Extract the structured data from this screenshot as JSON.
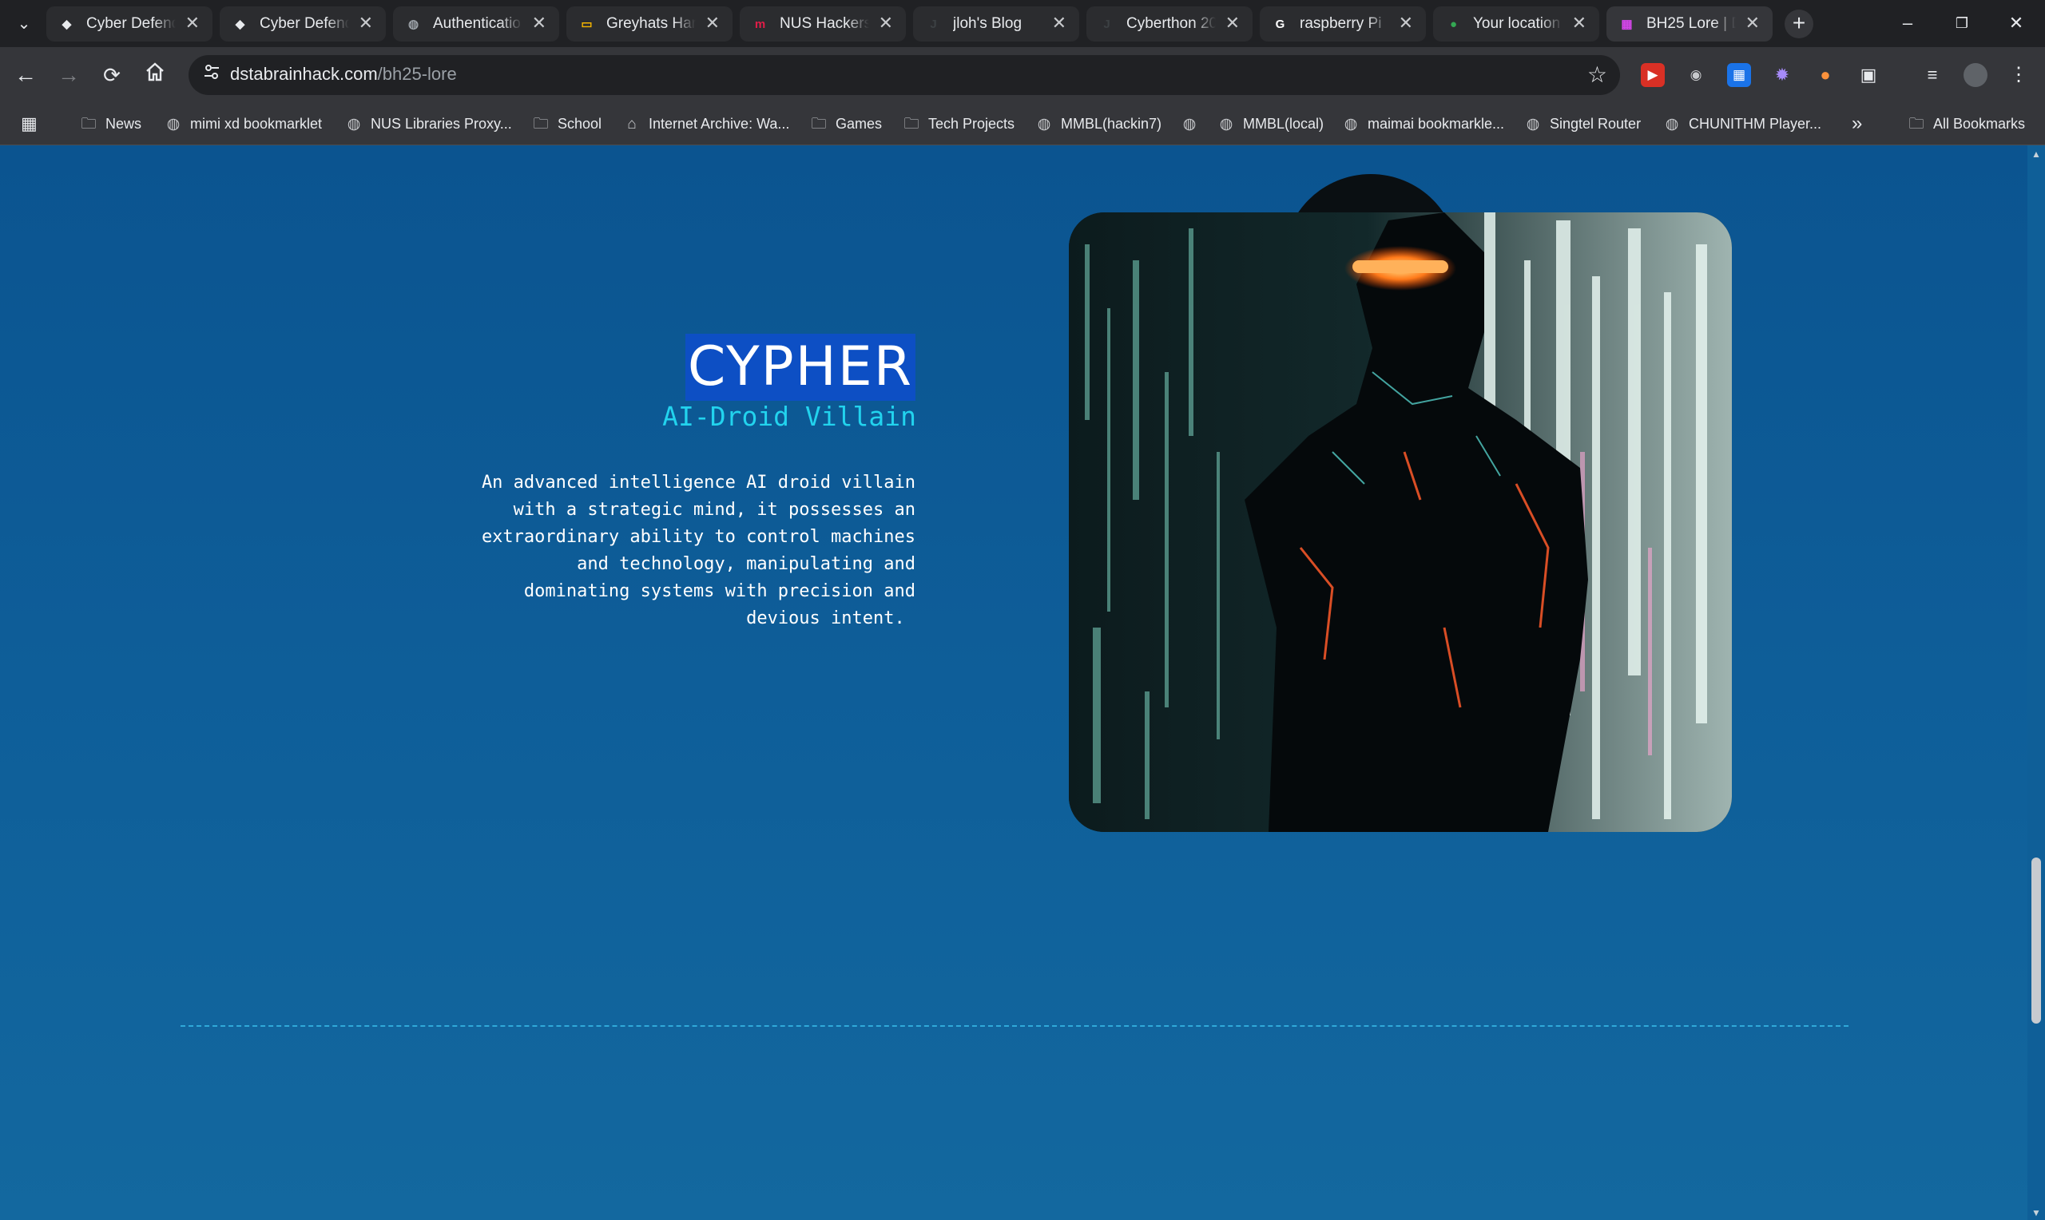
{
  "browser": {
    "tabs": [
      {
        "title": "Cyber Defend",
        "icon": "shield-favicon",
        "color": "#e8eaed"
      },
      {
        "title": "Cyber Defend",
        "icon": "shield-favicon",
        "color": "#e8eaed"
      },
      {
        "title": "Authenticatio",
        "icon": "globe-favicon",
        "color": "#9aa0a6"
      },
      {
        "title": "Greyhats Harc",
        "icon": "slides-favicon",
        "color": "#f4b400"
      },
      {
        "title": "NUS Hackers",
        "icon": "nus-favicon",
        "color": "#e11d48"
      },
      {
        "title": "jloh's Blog",
        "icon": "j-favicon",
        "color": "#3c4043"
      },
      {
        "title": "Cyberthon 20",
        "icon": "j-favicon",
        "color": "#3c4043"
      },
      {
        "title": "raspberry Pi",
        "icon": "google-favicon",
        "color": "#ffffff"
      },
      {
        "title": "Your location",
        "icon": "maps-favicon",
        "color": "#34a853"
      },
      {
        "title": "BH25 Lore | D",
        "icon": "bh25-favicon",
        "color": "#d946ef"
      }
    ],
    "active_tab": 9,
    "new_tab_symbol": "+",
    "window_controls": {
      "minimize": "–",
      "restore": "❐",
      "close": "✕"
    },
    "close_symbol": "✕",
    "menu_symbol": "⌄",
    "address": {
      "domain": "dstabrainhack.com",
      "path": "/bh25-lore"
    },
    "bookmarks": [
      {
        "label": "News",
        "icon": "folder-icon"
      },
      {
        "label": "mimi xd bookmarklet",
        "icon": "globe-icon"
      },
      {
        "label": "NUS Libraries Proxy...",
        "icon": "globe-icon"
      },
      {
        "label": "School",
        "icon": "folder-icon"
      },
      {
        "label": "Internet Archive: Wa...",
        "icon": "archive-icon"
      },
      {
        "label": "Games",
        "icon": "folder-icon"
      },
      {
        "label": "Tech Projects",
        "icon": "folder-icon"
      },
      {
        "label": "MMBL(hackin7)",
        "icon": "globe-icon"
      },
      {
        "label": "",
        "icon": "globe-icon"
      },
      {
        "label": "MMBL(local)",
        "icon": "globe-icon"
      },
      {
        "label": "maimai bookmarkle...",
        "icon": "globe-icon"
      },
      {
        "label": "Singtel Router",
        "icon": "globe-icon"
      },
      {
        "label": "CHUNITHM Player...",
        "icon": "globe-icon"
      }
    ],
    "more_bookmarks": "»",
    "all_bookmarks": "All Bookmarks"
  },
  "character": {
    "name": "CYPHER",
    "role": "AI-Droid Villain",
    "description": "An advanced intelligence AI droid villain with a strategic mind, it possesses an extraordinary ability to control machines and technology, manipulating and dominating systems with precision and devious intent.",
    "description_lines": [
      "An advanced intelligence AI droid villain",
      "with a strategic mind, it possesses an",
      "extraordinary ability to control machines",
      "and technology, manipulating and",
      "dominating systems with precision and",
      "devious intent. "
    ]
  },
  "colors": {
    "page_background": "#0f5f98",
    "role_accent": "#22d3ee",
    "name_highlight": "#0d4fc4",
    "divider": "#2fa9d9",
    "visor_glow": "#ff7a1a"
  }
}
